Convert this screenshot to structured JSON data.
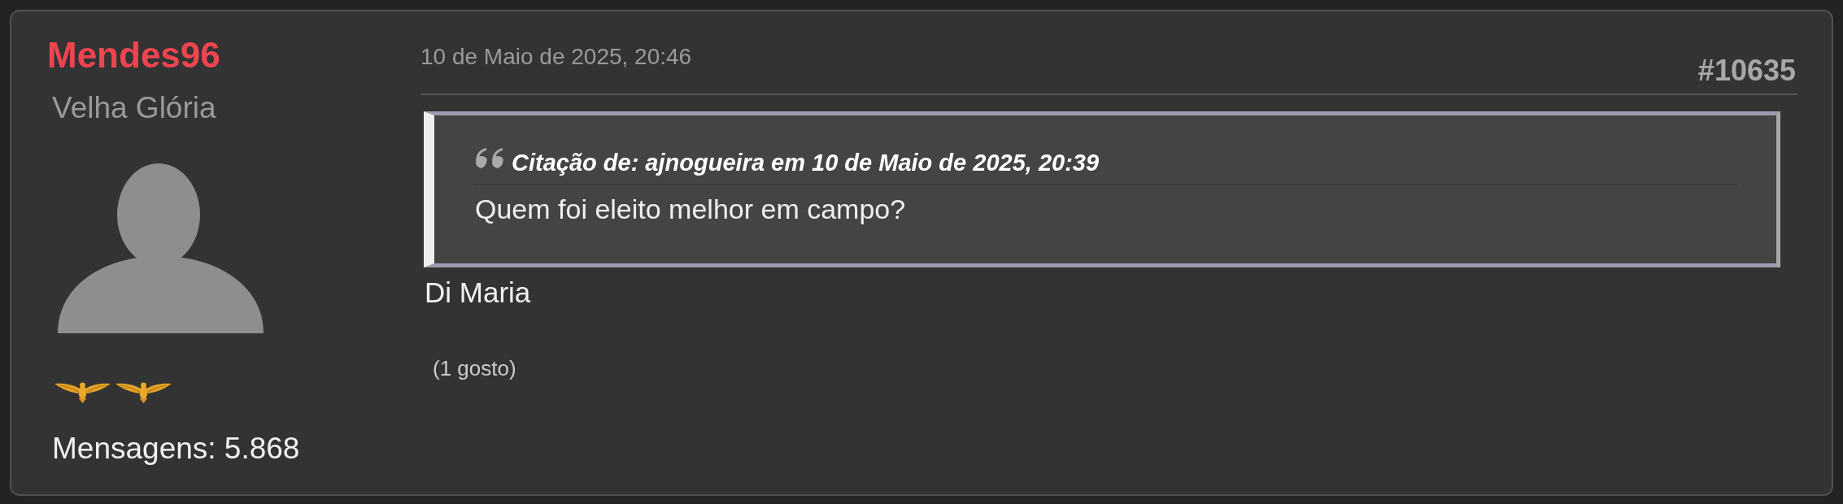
{
  "author": {
    "username": "Mendes96",
    "rank": "Velha Glória",
    "insignia": [
      {
        "kind": "eagle"
      },
      {
        "kind": "eagle"
      }
    ],
    "post_count": "Mensagens: 5.868"
  },
  "header": {
    "date": "10 de Maio de 2025, 20:46",
    "post_number": "#10635"
  },
  "quote": {
    "header": "Citação de: ajnogueira em 10 de Maio de 2025, 20:39",
    "text": "Quem foi eleito melhor em campo?"
  },
  "body": "Di Maria",
  "likes": "(1 gosto)"
}
